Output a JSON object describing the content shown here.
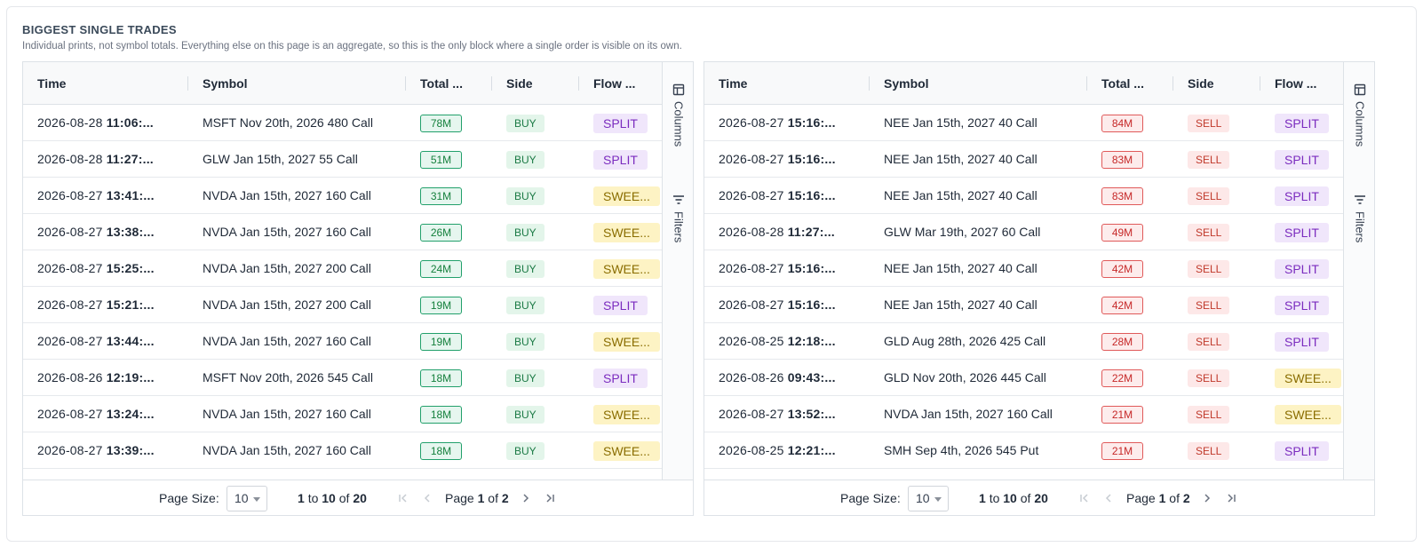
{
  "header": {
    "title": "BIGGEST SINGLE TRADES",
    "subtitle": "Individual prints, not symbol totals. Everything else on this page is an aggregate, so this is the only block where a single order is visible on its own."
  },
  "colors": {
    "buy": "#22a06b",
    "sell": "#e05a5a",
    "split": "#7b2cbf",
    "sweep": "#8a6d00"
  },
  "grids": [
    {
      "columns": [
        "Time",
        "Symbol",
        "Total ...",
        "Side",
        "Flow ..."
      ],
      "sidebar": {
        "columns_label": "Columns",
        "filters_label": "Filters"
      },
      "rows": [
        {
          "date": "2026-08-28",
          "time": "11:06:...",
          "symbol": "MSFT Nov 20th, 2026 480 Call",
          "total": "78M",
          "side": "BUY",
          "flow": "SPLIT"
        },
        {
          "date": "2026-08-28",
          "time": "11:27:...",
          "symbol": "GLW Jan 15th, 2027 55 Call",
          "total": "51M",
          "side": "BUY",
          "flow": "SPLIT"
        },
        {
          "date": "2026-08-27",
          "time": "13:41:...",
          "symbol": "NVDA Jan 15th, 2027 160 Call",
          "total": "31M",
          "side": "BUY",
          "flow": "SWEE..."
        },
        {
          "date": "2026-08-27",
          "time": "13:38:...",
          "symbol": "NVDA Jan 15th, 2027 160 Call",
          "total": "26M",
          "side": "BUY",
          "flow": "SWEE..."
        },
        {
          "date": "2026-08-27",
          "time": "15:25:...",
          "symbol": "NVDA Jan 15th, 2027 200 Call",
          "total": "24M",
          "side": "BUY",
          "flow": "SWEE..."
        },
        {
          "date": "2026-08-27",
          "time": "15:21:...",
          "symbol": "NVDA Jan 15th, 2027 200 Call",
          "total": "19M",
          "side": "BUY",
          "flow": "SPLIT"
        },
        {
          "date": "2026-08-27",
          "time": "13:44:...",
          "symbol": "NVDA Jan 15th, 2027 160 Call",
          "total": "19M",
          "side": "BUY",
          "flow": "SWEE..."
        },
        {
          "date": "2026-08-26",
          "time": "12:19:...",
          "symbol": "MSFT Nov 20th, 2026 545 Call",
          "total": "18M",
          "side": "BUY",
          "flow": "SPLIT"
        },
        {
          "date": "2026-08-27",
          "time": "13:24:...",
          "symbol": "NVDA Jan 15th, 2027 160 Call",
          "total": "18M",
          "side": "BUY",
          "flow": "SWEE..."
        },
        {
          "date": "2026-08-27",
          "time": "13:39:...",
          "symbol": "NVDA Jan 15th, 2027 160 Call",
          "total": "18M",
          "side": "BUY",
          "flow": "SWEE..."
        }
      ],
      "footer": {
        "page_size_label": "Page Size:",
        "page_size": "10",
        "range_from": "1",
        "range_to_word": "to",
        "range_to": "10",
        "range_of_word": "of",
        "range_total": "20",
        "page_word": "Page",
        "page_current": "1",
        "page_of_word": "of",
        "page_total": "2"
      }
    },
    {
      "columns": [
        "Time",
        "Symbol",
        "Total ...",
        "Side",
        "Flow ..."
      ],
      "sidebar": {
        "columns_label": "Columns",
        "filters_label": "Filters"
      },
      "rows": [
        {
          "date": "2026-08-27",
          "time": "15:16:...",
          "symbol": "NEE Jan 15th, 2027 40 Call",
          "total": "84M",
          "side": "SELL",
          "flow": "SPLIT"
        },
        {
          "date": "2026-08-27",
          "time": "15:16:...",
          "symbol": "NEE Jan 15th, 2027 40 Call",
          "total": "83M",
          "side": "SELL",
          "flow": "SPLIT"
        },
        {
          "date": "2026-08-27",
          "time": "15:16:...",
          "symbol": "NEE Jan 15th, 2027 40 Call",
          "total": "83M",
          "side": "SELL",
          "flow": "SPLIT"
        },
        {
          "date": "2026-08-28",
          "time": "11:27:...",
          "symbol": "GLW Mar 19th, 2027 60 Call",
          "total": "49M",
          "side": "SELL",
          "flow": "SPLIT"
        },
        {
          "date": "2026-08-27",
          "time": "15:16:...",
          "symbol": "NEE Jan 15th, 2027 40 Call",
          "total": "42M",
          "side": "SELL",
          "flow": "SPLIT"
        },
        {
          "date": "2026-08-27",
          "time": "15:16:...",
          "symbol": "NEE Jan 15th, 2027 40 Call",
          "total": "42M",
          "side": "SELL",
          "flow": "SPLIT"
        },
        {
          "date": "2026-08-25",
          "time": "12:18:...",
          "symbol": "GLD Aug 28th, 2026 425 Call",
          "total": "28M",
          "side": "SELL",
          "flow": "SPLIT"
        },
        {
          "date": "2026-08-26",
          "time": "09:43:...",
          "symbol": "GLD Nov 20th, 2026 445 Call",
          "total": "22M",
          "side": "SELL",
          "flow": "SWEE..."
        },
        {
          "date": "2026-08-27",
          "time": "13:52:...",
          "symbol": "NVDA Jan 15th, 2027 160 Call",
          "total": "21M",
          "side": "SELL",
          "flow": "SWEE..."
        },
        {
          "date": "2026-08-25",
          "time": "12:21:...",
          "symbol": "SMH Sep 4th, 2026 545 Put",
          "total": "21M",
          "side": "SELL",
          "flow": "SPLIT"
        }
      ],
      "footer": {
        "page_size_label": "Page Size:",
        "page_size": "10",
        "range_from": "1",
        "range_to_word": "to",
        "range_to": "10",
        "range_of_word": "of",
        "range_total": "20",
        "page_word": "Page",
        "page_current": "1",
        "page_of_word": "of",
        "page_total": "2"
      }
    }
  ]
}
